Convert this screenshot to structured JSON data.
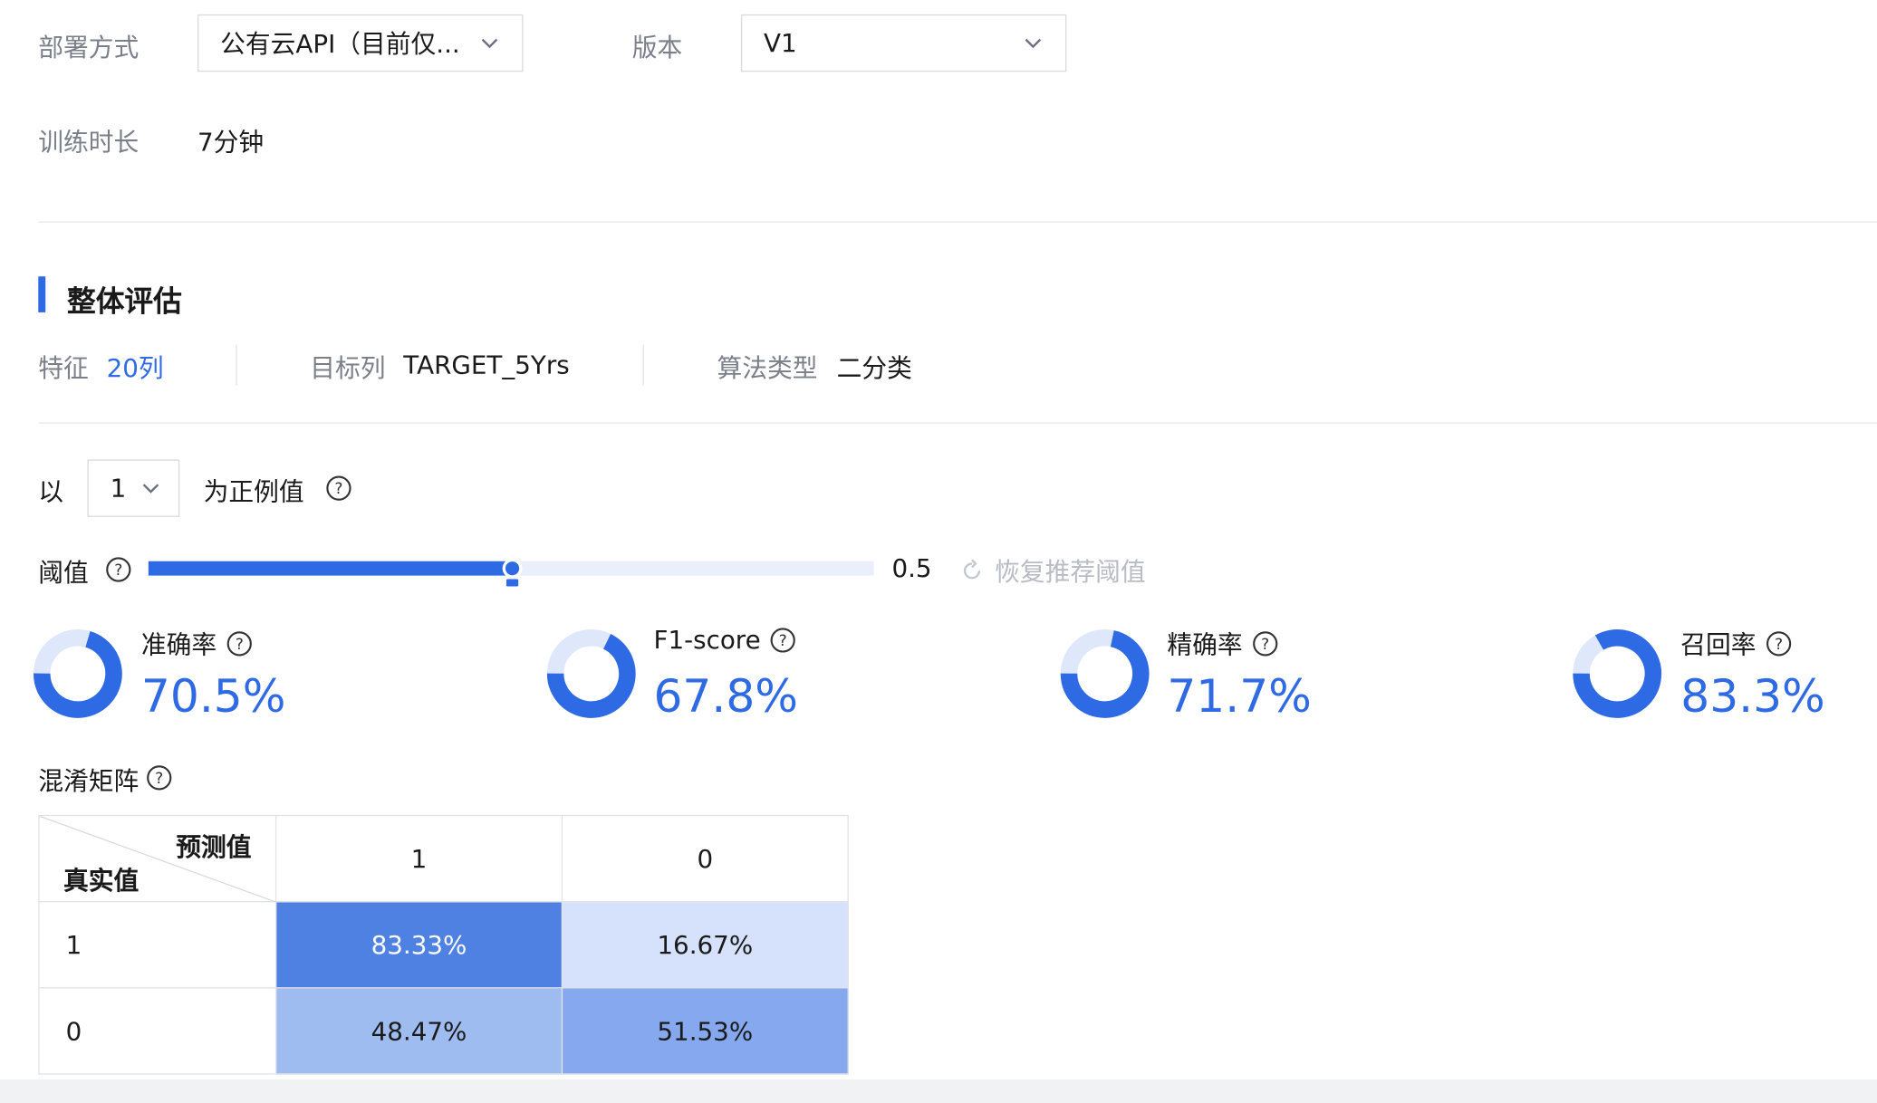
{
  "deploy": {
    "label": "部署方式",
    "value": "公有云API（目前仅...",
    "version_label": "版本",
    "version_value": "V1",
    "duration_label": "训练时长",
    "duration_value": "7分钟"
  },
  "evaluation": {
    "title": "整体评估",
    "features_label": "特征",
    "features_value": "20列",
    "target_label": "目标列",
    "target_value": "TARGET_5Yrs",
    "algo_label": "算法类型",
    "algo_value": "二分类"
  },
  "positive": {
    "prefix": "以",
    "value": "1",
    "suffix": "为正例值"
  },
  "threshold": {
    "label": "阈值",
    "value": "0.5",
    "fraction": 0.5,
    "reset_label": "恢复推荐阈值"
  },
  "metrics": [
    {
      "label": "准确率",
      "value": "70.5%",
      "fraction": 0.705
    },
    {
      "label": "F1-score",
      "value": "67.8%",
      "fraction": 0.678
    },
    {
      "label": "精确率",
      "value": "71.7%",
      "fraction": 0.717
    },
    {
      "label": "召回率",
      "value": "83.3%",
      "fraction": 0.833
    }
  ],
  "confusion": {
    "title": "混淆矩阵",
    "predicted_label": "预测值",
    "actual_label": "真实值",
    "col_headers": [
      "1",
      "0"
    ],
    "rows": [
      {
        "label": "1",
        "cells": [
          "83.33%",
          "16.67%"
        ]
      },
      {
        "label": "0",
        "cells": [
          "48.47%",
          "51.53%"
        ]
      }
    ],
    "colors": {
      "dark": "#4f81e3",
      "light": "#d6e2fb",
      "mid1": "#9fbcf1",
      "mid2": "#86a8ee"
    }
  },
  "colors": {
    "accent": "#2f6ae5",
    "track": "#e9effb",
    "donut_bg": "#dfe7fb"
  }
}
